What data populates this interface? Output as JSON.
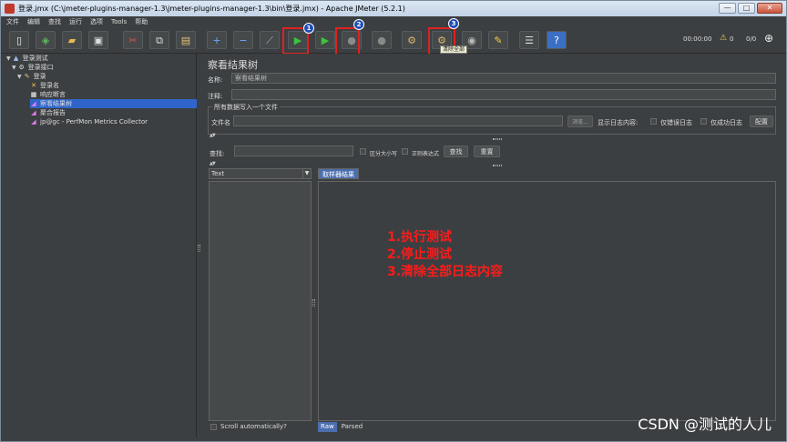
{
  "window": {
    "title": "登录.jmx (C:\\jmeter-plugins-manager-1.3\\jmeter-plugins-manager-1.3\\bin\\登录.jmx) - Apache JMeter (5.2.1)",
    "buttons": [
      "—",
      "□",
      "✕"
    ]
  },
  "menu": [
    "文件",
    "编辑",
    "查找",
    "运行",
    "选项",
    "Tools",
    "帮助"
  ],
  "toolbar": {
    "badges": [
      "1",
      "2",
      "3"
    ],
    "tooltip": "清除全部",
    "timer": "00:00:00",
    "warning_count": "0",
    "threads": "0/0",
    "icons": [
      {
        "name": "new-icon",
        "glyph": "▯"
      },
      {
        "name": "templates-icon",
        "glyph": "◈"
      },
      {
        "name": "open-icon",
        "glyph": "▰"
      },
      {
        "name": "save-icon",
        "glyph": "▣"
      },
      {
        "name": "cut-icon",
        "glyph": "✂"
      },
      {
        "name": "copy-icon",
        "glyph": "⧉"
      },
      {
        "name": "paste-icon",
        "glyph": "▤"
      },
      {
        "name": "expand-icon",
        "glyph": "+"
      },
      {
        "name": "collapse-icon",
        "glyph": "−"
      },
      {
        "name": "toggle-icon",
        "glyph": "⟋"
      },
      {
        "name": "start-icon",
        "glyph": "▶"
      },
      {
        "name": "start-no-pauses-icon",
        "glyph": "▶"
      },
      {
        "name": "stop-icon",
        "glyph": "●"
      },
      {
        "name": "shutdown-icon",
        "glyph": "●"
      },
      {
        "name": "clear-icon",
        "glyph": "⚙"
      },
      {
        "name": "clear-all-icon",
        "glyph": "⚙"
      },
      {
        "name": "search-icon",
        "glyph": "◉"
      },
      {
        "name": "reset-search-icon",
        "glyph": "✎"
      },
      {
        "name": "function-helper-icon",
        "glyph": "☰"
      },
      {
        "name": "help-icon",
        "glyph": "?"
      }
    ]
  },
  "tree": [
    {
      "label": "登录测试",
      "icon": "▲"
    },
    {
      "label": "登录接口",
      "icon": "⚙"
    },
    {
      "label": "登录",
      "icon": "✎"
    },
    {
      "label": "登录名",
      "icon": "✕"
    },
    {
      "label": "响应断言",
      "icon": "▦"
    },
    {
      "label": "察看结果树",
      "icon": "◢"
    },
    {
      "label": "聚合报告",
      "icon": "◢"
    },
    {
      "label": "jp@gc - PerfMon Metrics Collector",
      "icon": "◢"
    }
  ],
  "panel": {
    "title": "察看结果树",
    "name_label": "名称:",
    "name_value": "察看结果树",
    "comment_label": "注释:",
    "comment_value": "",
    "group_title": "所有数据写入一个文件",
    "filename_label": "文件名",
    "browse_btn": "浏览...",
    "log_label": "显示日志内容:",
    "errors_only": "仅错误日志",
    "success_only": "仅成功日志",
    "config_btn": "配置",
    "search_label": "查找:",
    "case_sensitive": "区分大小写",
    "regex": "正则表达式",
    "search_btn": "查找",
    "reset_btn": "重置",
    "renderer": "Text",
    "result_tab": "取样器结果",
    "scroll_auto": "Scroll automatically?",
    "bottom_tabs": [
      "Raw",
      "Parsed"
    ]
  },
  "annotation": [
    "1.执行测试",
    "2.停止测试",
    "3.清除全部日志内容"
  ],
  "watermark": "CSDN @测试的人儿",
  "colors": {
    "background": "#3c3f41",
    "selection": "#2f65ca",
    "highlight": "#e02020",
    "annotation": "#ff1a1a",
    "badge": "#1f4fb8"
  }
}
